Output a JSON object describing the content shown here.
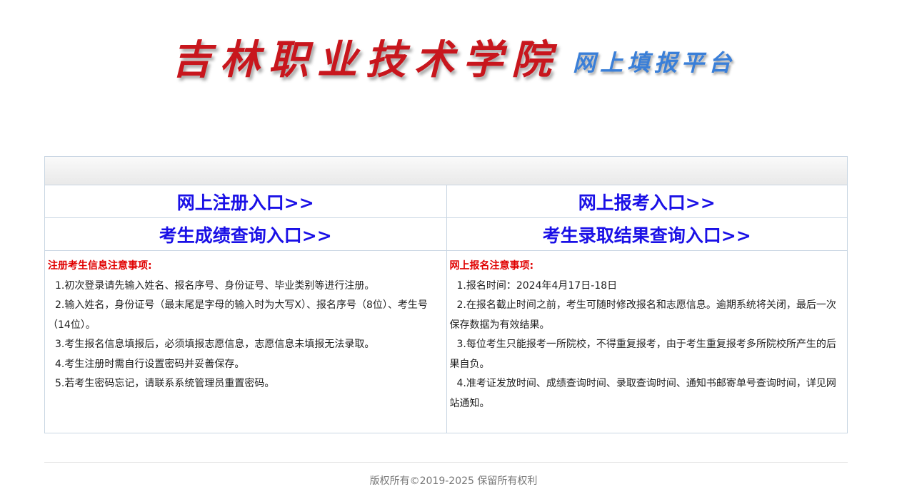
{
  "header": {
    "title": "吉林职业技术学院",
    "subtitle": "网上填报平台"
  },
  "links": {
    "register": "网上注册入口>>",
    "apply": "网上报考入口>>",
    "score_query": "考生成绩查询入口>>",
    "admission_query": "考生录取结果查询入口>>"
  },
  "notes": {
    "register": {
      "title": "注册考生信息注意事项:",
      "items": [
        "1.初次登录请先输入姓名、报名序号、身份证号、毕业类别等进行注册。",
        " 2.输入姓名，身份证号（最末尾是字母的输入时为大写X）、报名序号（8位）、考生号（14位）。",
        "3.考生报名信息填报后，必须填报志愿信息，志愿信息未填报无法录取。",
        "4.考生注册时需自行设置密码并妥善保存。",
        "5.若考生密码忘记，请联系系统管理员重置密码。"
      ]
    },
    "apply": {
      "title": "网上报名注意事项:",
      "items": [
        "1.报名时间：2024年4月17日-18日",
        "2.在报名截止时间之前，考生可随时修改报名和志愿信息。逾期系统将关闭，最后一次保存数据为有效结果。",
        "3.每位考生只能报考一所院校，不得重复报考，由于考生重复报考多所院校所产生的后果自负。",
        "4.准考证发放时间、成绩查询时间、录取查询时间、通知书邮寄单号查询时间，详见网站通知。"
      ]
    }
  },
  "footer": {
    "copyright": "版权所有©2019-2025 保留所有权利"
  },
  "colors": {
    "title_red": "#c8161d",
    "subtitle_blue": "#3a7fd8",
    "link_blue": "#1a10e6",
    "note_title_red": "#e00000"
  }
}
